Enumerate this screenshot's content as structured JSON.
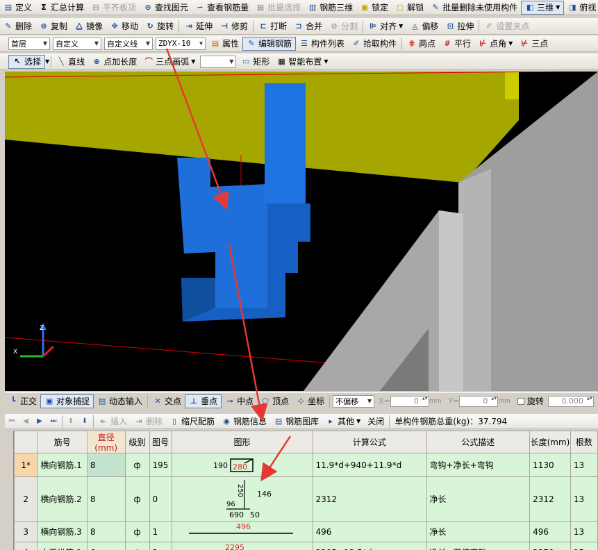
{
  "toolbar1": {
    "items": [
      {
        "label": "定义",
        "icon": "define-icon",
        "enabled": true
      },
      {
        "label": "汇总计算",
        "icon": "sigma-icon",
        "enabled": true
      },
      {
        "label": "平齐板顶",
        "icon": "level-slab-icon",
        "enabled": false
      },
      {
        "label": "查找图元",
        "icon": "binoculars-icon",
        "enabled": true
      },
      {
        "label": "查看钢筋量",
        "icon": "view-rebar-icon",
        "enabled": true
      },
      {
        "label": "批量选择",
        "icon": "batch-select-icon",
        "enabled": false
      },
      {
        "label": "钢筋三维",
        "icon": "rebar-3d-icon",
        "enabled": true
      },
      {
        "label": "锁定",
        "icon": "lock-icon",
        "enabled": true
      },
      {
        "label": "解锁",
        "icon": "unlock-icon",
        "enabled": true
      },
      {
        "label": "批量删除未使用构件",
        "icon": "batch-delete-icon",
        "enabled": true
      },
      {
        "label": "三维",
        "icon": "cube-icon",
        "enabled": true
      },
      {
        "label": "俯视",
        "icon": "top-view-icon",
        "enabled": true
      }
    ]
  },
  "toolbar2": {
    "items": [
      {
        "label": "删除",
        "icon": "delete-icon",
        "enabled": true
      },
      {
        "label": "复制",
        "icon": "copy-icon",
        "enabled": true
      },
      {
        "label": "镜像",
        "icon": "mirror-icon",
        "enabled": true
      },
      {
        "label": "移动",
        "icon": "move-icon",
        "enabled": true
      },
      {
        "label": "旋转",
        "icon": "rotate-icon",
        "enabled": true
      },
      {
        "label": "延伸",
        "icon": "extend-icon",
        "enabled": true
      },
      {
        "label": "修剪",
        "icon": "trim-icon",
        "enabled": true
      },
      {
        "label": "打断",
        "icon": "break-icon",
        "enabled": true
      },
      {
        "label": "合并",
        "icon": "merge-icon",
        "enabled": true
      },
      {
        "label": "分割",
        "icon": "split-icon",
        "enabled": false
      },
      {
        "label": "对齐",
        "icon": "align-icon",
        "enabled": true
      },
      {
        "label": "偏移",
        "icon": "offset-icon",
        "enabled": true
      },
      {
        "label": "拉伸",
        "icon": "stretch-icon",
        "enabled": true
      },
      {
        "label": "设置夹点",
        "icon": "grip-icon",
        "enabled": false
      }
    ]
  },
  "toolbar3": {
    "floor": "首层",
    "category": "自定义",
    "type": "自定义线",
    "component": "ZDYX-10",
    "buttons": [
      {
        "label": "属性",
        "icon": "properties-icon"
      },
      {
        "label": "编辑钢筋",
        "icon": "edit-rebar-icon"
      },
      {
        "label": "构件列表",
        "icon": "list-icon"
      },
      {
        "label": "拾取构件",
        "icon": "pick-icon"
      }
    ],
    "snap_buttons": [
      {
        "label": "两点",
        "icon": "two-point-icon"
      },
      {
        "label": "平行",
        "icon": "parallel-icon"
      },
      {
        "label": "点角",
        "icon": "point-angle-icon"
      },
      {
        "label": "三点",
        "icon": "three-point-icon"
      }
    ]
  },
  "toolbar4": {
    "select": "选择",
    "line": "直线",
    "point_length": "点加长度",
    "arc": "三点画弧",
    "rect": "矩形",
    "smart_layout": "智能布置"
  },
  "statusbar": {
    "ortho": "正交",
    "snap": "对象捕捉",
    "dynamic_input": "动态输入",
    "intersection": "交点",
    "perpendicular": "垂点",
    "midpoint": "中点",
    "vertex": "顶点",
    "coordinate": "坐标",
    "offset_mode": "不偏移",
    "x_label": "X=",
    "x_value": "0",
    "y_label": "Y=",
    "y_value": "0",
    "unit": "mm",
    "rotate_label": "旋转",
    "rotate_value": "0.000"
  },
  "gridbar": {
    "insert": "插入",
    "delete": "删除",
    "scale_rebar": "缩尺配筋",
    "rebar_info": "钢筋信息",
    "rebar_library": "钢筋图库",
    "other": "其他",
    "close": "关闭",
    "total_weight_label": "单构件钢筋总重(kg)：37.794"
  },
  "grid": {
    "columns": [
      "",
      "筋号",
      "直径(mm)",
      "级别",
      "图号",
      "图形",
      "计算公式",
      "公式描述",
      "长度(mm)",
      "根数"
    ],
    "rows": [
      {
        "idx": "1*",
        "name": "横向钢筋.1",
        "dia": "8",
        "grade": "ф",
        "fig": "195",
        "formula": "11.9*d+940+11.9*d",
        "desc": "弯钩+净长+弯钩",
        "length": "1130",
        "count": "13",
        "shape": {
          "a": "190",
          "b": "280"
        }
      },
      {
        "idx": "2",
        "name": "横向钢筋.2",
        "dia": "8",
        "grade": "ф",
        "fig": "0",
        "formula": "2312",
        "desc": "净长",
        "length": "2312",
        "count": "13",
        "shape": {
          "a": "250",
          "b": "146",
          "c": "96",
          "d": "690",
          "e": "50"
        }
      },
      {
        "idx": "3",
        "name": "横向钢筋.3",
        "dia": "8",
        "grade": "ф",
        "fig": "1",
        "formula": "496",
        "desc": "净长",
        "length": "496",
        "count": "13",
        "shape": {
          "a": "496"
        }
      },
      {
        "idx": "4",
        "name": "水平纵筋.1",
        "dia": "6",
        "grade": "ф",
        "fig": "3",
        "formula": "2295+12.5*d",
        "desc": "净长+两倍弯钩",
        "length": "2370",
        "count": "15",
        "shape": {
          "a": "2295"
        }
      }
    ]
  },
  "colors": {
    "grid_cell": "#d8f5d8",
    "arrow": "#e53935",
    "rebar_block": "#1e6fd9",
    "slab": "#b3b300"
  }
}
